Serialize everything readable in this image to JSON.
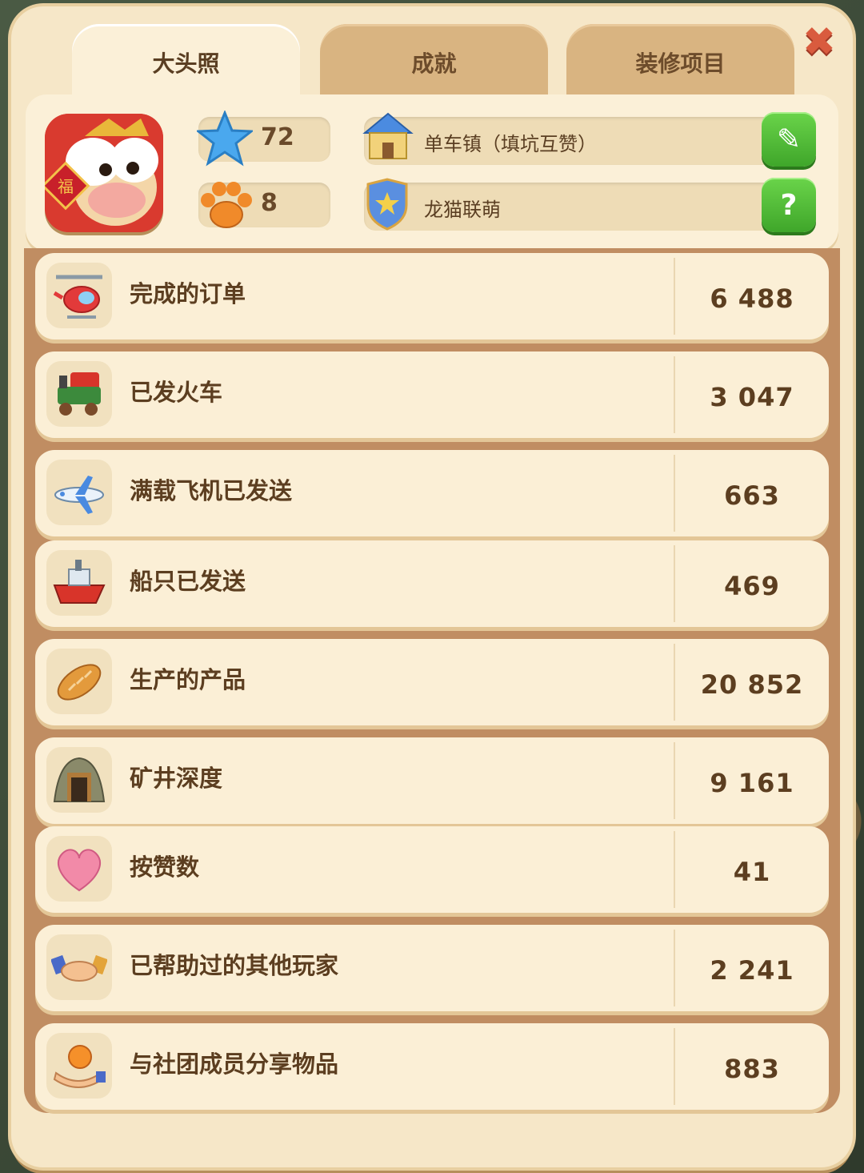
{
  "tabs": [
    {
      "label": "大头照",
      "active": true
    },
    {
      "label": "成就",
      "active": false
    },
    {
      "label": "装修项目",
      "active": false
    }
  ],
  "close_icon": "close-x",
  "profile": {
    "level": "72",
    "paws": "8",
    "town_name": "单车镇（填坑互赞）",
    "club_name": "龙猫联萌"
  },
  "stats": [
    {
      "icon": "helicopter-icon",
      "label": "完成的订单",
      "value": "6 488"
    },
    {
      "icon": "train-icon",
      "label": "已发火车",
      "value": "3 047"
    },
    {
      "icon": "airplane-icon",
      "label": "满载飞机已发送",
      "value": "663"
    },
    {
      "icon": "ship-icon",
      "label": "船只已发送",
      "value": "469"
    },
    {
      "icon": "bread-icon",
      "label": "生产的产品",
      "value": "20 852"
    },
    {
      "icon": "mine-icon",
      "label": "矿井深度",
      "value": "9 161"
    },
    {
      "icon": "heart-icon",
      "label": "按赞数",
      "value": "41"
    },
    {
      "icon": "handshake-icon",
      "label": "已帮助过的其他玩家",
      "value": "2 241"
    },
    {
      "icon": "orange-hand-icon",
      "label": "与社团成员分享物品",
      "value": "883"
    }
  ],
  "colors": {
    "panel": "#f6e7c8",
    "tab_inactive": "#d9b481",
    "green": "#3fa62a",
    "text": "#5c3e20"
  }
}
